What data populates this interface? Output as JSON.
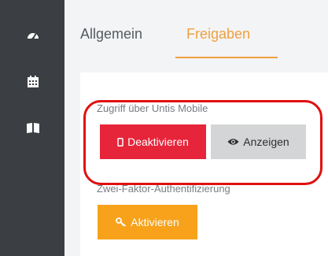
{
  "sidebar": {
    "items": [
      {
        "icon": "dashboard-icon"
      },
      {
        "icon": "calendar-icon"
      },
      {
        "icon": "book-icon"
      }
    ]
  },
  "tabs": [
    {
      "label": "Allgemein",
      "active": false
    },
    {
      "label": "Freigaben",
      "active": true
    }
  ],
  "sections": {
    "untis_mobile": {
      "label": "Zugriff über Untis Mobile",
      "deactivate_label": "Deaktivieren",
      "show_label": "Anzeigen"
    },
    "two_factor": {
      "label": "Zwei-Faktor-Authentifizierung",
      "activate_label": "Aktivieren"
    }
  },
  "colors": {
    "sidebar": "#3b3f44",
    "accent": "#f0a040",
    "danger": "#e6253a",
    "warning": "#f7a21a",
    "highlight": "#e01010"
  }
}
